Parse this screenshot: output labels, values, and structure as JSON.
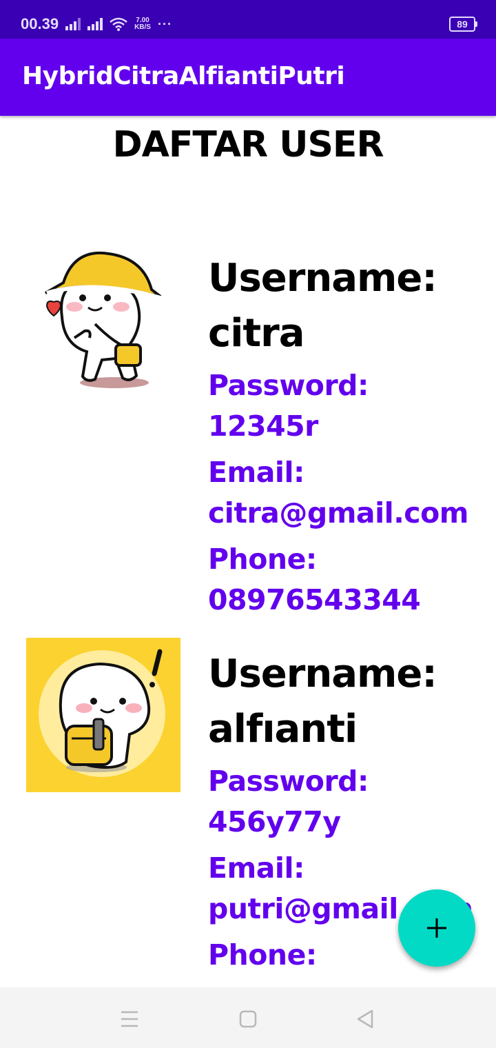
{
  "status_bar": {
    "time": "00.39",
    "speed_value": "7.00",
    "speed_unit": "KB/S",
    "more": "···",
    "battery": "89"
  },
  "app_bar": {
    "title": "HybridCitraAlfiantiPutri"
  },
  "page": {
    "heading": "DAFTAR USER"
  },
  "users": [
    {
      "username": "Username:\ncitra",
      "password": "Password:\n12345r",
      "email": "Email:\ncitra@gmail.com",
      "phone": "Phone:\n08976543344",
      "avatar_icon": "helmet-character-icon"
    },
    {
      "username": "Username:\nalfıanti",
      "password": "Password:\n456y77y",
      "email": "Email:\nputri@gmail.com",
      "phone": "Phone:",
      "avatar_icon": "backpack-character-icon"
    }
  ],
  "fab": {
    "label": "+",
    "icon": "add-icon"
  },
  "nav_bar": {
    "icons": [
      "menu-icon",
      "home-icon",
      "back-icon"
    ]
  },
  "colors": {
    "status_bar": "#3a00b3",
    "primary": "#6200ee",
    "accent": "#03dac5"
  }
}
